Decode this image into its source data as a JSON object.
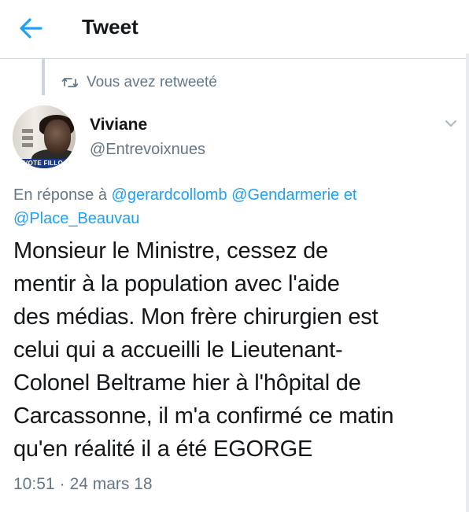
{
  "header": {
    "title": "Tweet"
  },
  "retweet_note": {
    "label": "Vous avez retweeté"
  },
  "author": {
    "name": "Viviane",
    "handle": "@Entrevoixnues",
    "avatar_banner": "VOTE FILLO"
  },
  "reply": {
    "prefix": "En réponse à",
    "mentions": [
      "@gerardcollomb",
      "@Gendarmerie"
    ],
    "conjunction": "et",
    "last_mention": "@Place_Beauvau"
  },
  "tweet": {
    "text": "Monsieur le Ministre, cessez de\nmentir à la population avec l'aide\ndes médias. Mon frère chirurgien est\ncelui qui a accueilli le Lieutenant-\nColonel Beltrame hier à l'hôpital de\nCarcassonne, il m'a confirmé ce matin\nqu'en réalité il a été EGORGE",
    "time": "10:51",
    "separator": "·",
    "date": "24 mars 18"
  },
  "colors": {
    "accent": "#1da1f2",
    "secondary_text": "#657786",
    "primary_text": "#14171a",
    "divider": "#d4d8dc"
  },
  "icons": {
    "back": "arrow-left-icon",
    "retweet": "retweet-icon",
    "more": "chevron-down-icon"
  }
}
